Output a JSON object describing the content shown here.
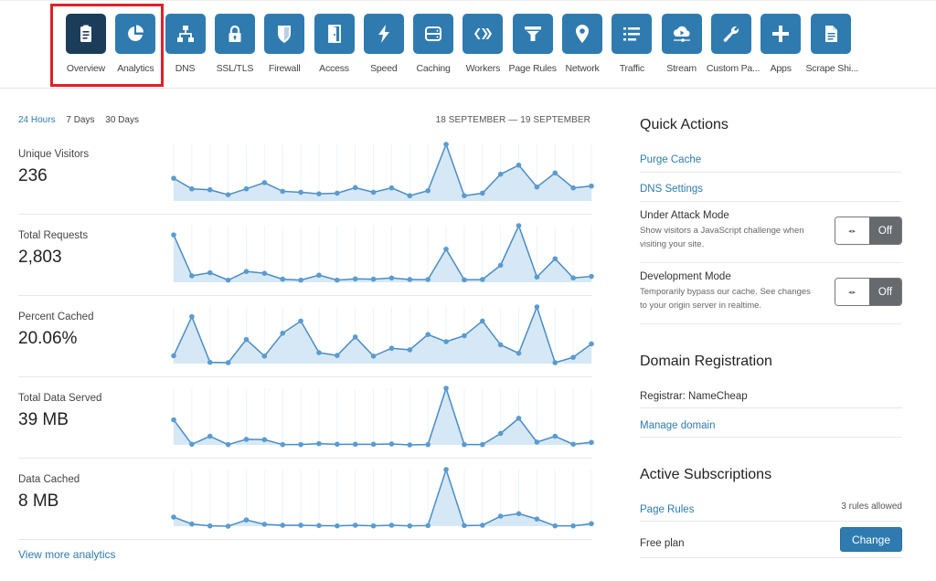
{
  "nav": {
    "items": [
      {
        "label": "Overview",
        "icon": "clipboard-icon",
        "active": true
      },
      {
        "label": "Analytics",
        "icon": "pie-chart-icon"
      },
      {
        "label": "DNS",
        "icon": "network-tree-icon"
      },
      {
        "label": "SSL/TLS",
        "icon": "lock-icon"
      },
      {
        "label": "Firewall",
        "icon": "shield-icon"
      },
      {
        "label": "Access",
        "icon": "door-icon"
      },
      {
        "label": "Speed",
        "icon": "lightning-icon"
      },
      {
        "label": "Caching",
        "icon": "server-icon"
      },
      {
        "label": "Workers",
        "icon": "workers-icon"
      },
      {
        "label": "Page Rules",
        "icon": "filter-icon"
      },
      {
        "label": "Network",
        "icon": "map-pin-icon"
      },
      {
        "label": "Traffic",
        "icon": "list-icon"
      },
      {
        "label": "Stream",
        "icon": "cloud-play-icon"
      },
      {
        "label": "Custom Pa...",
        "icon": "wrench-icon"
      },
      {
        "label": "Apps",
        "icon": "plus-icon"
      },
      {
        "label": "Scrape Shi...",
        "icon": "document-icon"
      }
    ]
  },
  "analytics": {
    "ranges": [
      "24 Hours",
      "7 Days",
      "30 Days"
    ],
    "active_range": "24 Hours",
    "date_range": "18 SEPTEMBER — 19 SEPTEMBER",
    "view_more": "View more analytics"
  },
  "chart_data": [
    {
      "type": "area",
      "title": "Unique Visitors",
      "summary": "236",
      "x": [
        1,
        2,
        3,
        4,
        5,
        6,
        7,
        8,
        9,
        10,
        11,
        12,
        13,
        14,
        15,
        16,
        17,
        18,
        19,
        20,
        21,
        22,
        23,
        24
      ],
      "values": [
        73,
        39,
        36,
        20,
        39,
        59,
        31,
        28,
        23,
        25,
        43,
        28,
        42,
        17,
        33,
        182,
        17,
        25,
        86,
        115,
        45,
        90,
        42,
        48
      ],
      "ylim": [
        0,
        182
      ]
    },
    {
      "type": "area",
      "title": "Total Requests",
      "summary": "2,803",
      "x": [
        1,
        2,
        3,
        4,
        5,
        6,
        7,
        8,
        9,
        10,
        11,
        12,
        13,
        14,
        15,
        16,
        17,
        18,
        19,
        20,
        21,
        22,
        23,
        24
      ],
      "values": [
        153,
        21,
        31,
        7,
        35,
        29,
        10,
        7,
        23,
        7,
        11,
        10,
        14,
        9,
        9,
        107,
        8,
        9,
        55,
        183,
        17,
        76,
        14,
        19
      ],
      "ylim": [
        0,
        183
      ]
    },
    {
      "type": "area",
      "title": "Percent Cached",
      "summary": "20.06%",
      "x": [
        1,
        2,
        3,
        4,
        5,
        6,
        7,
        8,
        9,
        10,
        11,
        12,
        13,
        14,
        15,
        16,
        17,
        18,
        19,
        20,
        21,
        22,
        23,
        24
      ],
      "values": [
        25,
        150,
        4,
        3,
        77,
        24,
        97,
        136,
        35,
        26,
        85,
        24,
        49,
        44,
        93,
        70,
        89,
        136,
        60,
        33,
        181,
        3,
        20,
        63
      ],
      "ylim": [
        0,
        181
      ]
    },
    {
      "type": "area",
      "title": "Total Data Served",
      "summary": "39 MB",
      "x": [
        1,
        2,
        3,
        4,
        5,
        6,
        7,
        8,
        9,
        10,
        11,
        12,
        13,
        14,
        15,
        16,
        17,
        18,
        19,
        20,
        21,
        22,
        23,
        24
      ],
      "values": [
        81,
        2,
        28,
        1,
        18,
        17,
        1,
        1,
        4,
        2,
        2,
        2,
        3,
        0,
        1,
        183,
        1,
        1,
        37,
        86,
        9,
        28,
        2,
        8
      ],
      "ylim": [
        0,
        183
      ]
    },
    {
      "type": "area",
      "title": "Data Cached",
      "summary": "8 MB",
      "x": [
        1,
        2,
        3,
        4,
        5,
        6,
        7,
        8,
        9,
        10,
        11,
        12,
        13,
        14,
        15,
        16,
        17,
        18,
        19,
        20,
        21,
        22,
        23,
        24
      ],
      "values": [
        29,
        7,
        1,
        0,
        20,
        6,
        3,
        3,
        2,
        1,
        3,
        1,
        3,
        1,
        2,
        181,
        2,
        3,
        32,
        40,
        23,
        1,
        1,
        8
      ],
      "ylim": [
        0,
        181
      ]
    }
  ],
  "colors": {
    "accent": "#2f7bb0",
    "active_nav": "#1b3d5a",
    "chart_line": "#5b9bd0",
    "chart_fill": "#d6e8f5",
    "highlight": "#e0202a"
  },
  "quick_actions": {
    "title": "Quick Actions",
    "purge_cache": "Purge Cache",
    "dns_settings": "DNS Settings",
    "under_attack": {
      "title": "Under Attack Mode",
      "desc": "Show visitors a JavaScript challenge when visiting your site.",
      "state": "Off",
      "knob": "◂▸"
    },
    "dev_mode": {
      "title": "Development Mode",
      "desc": "Temporarily bypass our cache. See changes to your origin server in realtime.",
      "state": "Off",
      "knob": "◂▸"
    }
  },
  "domain_registration": {
    "title": "Domain Registration",
    "registrar": "Registrar: NameCheap",
    "manage": "Manage domain"
  },
  "subscriptions": {
    "title": "Active Subscriptions",
    "page_rules": "Page Rules",
    "page_rules_info": "3 rules allowed",
    "plan": "Free plan",
    "change": "Change"
  }
}
